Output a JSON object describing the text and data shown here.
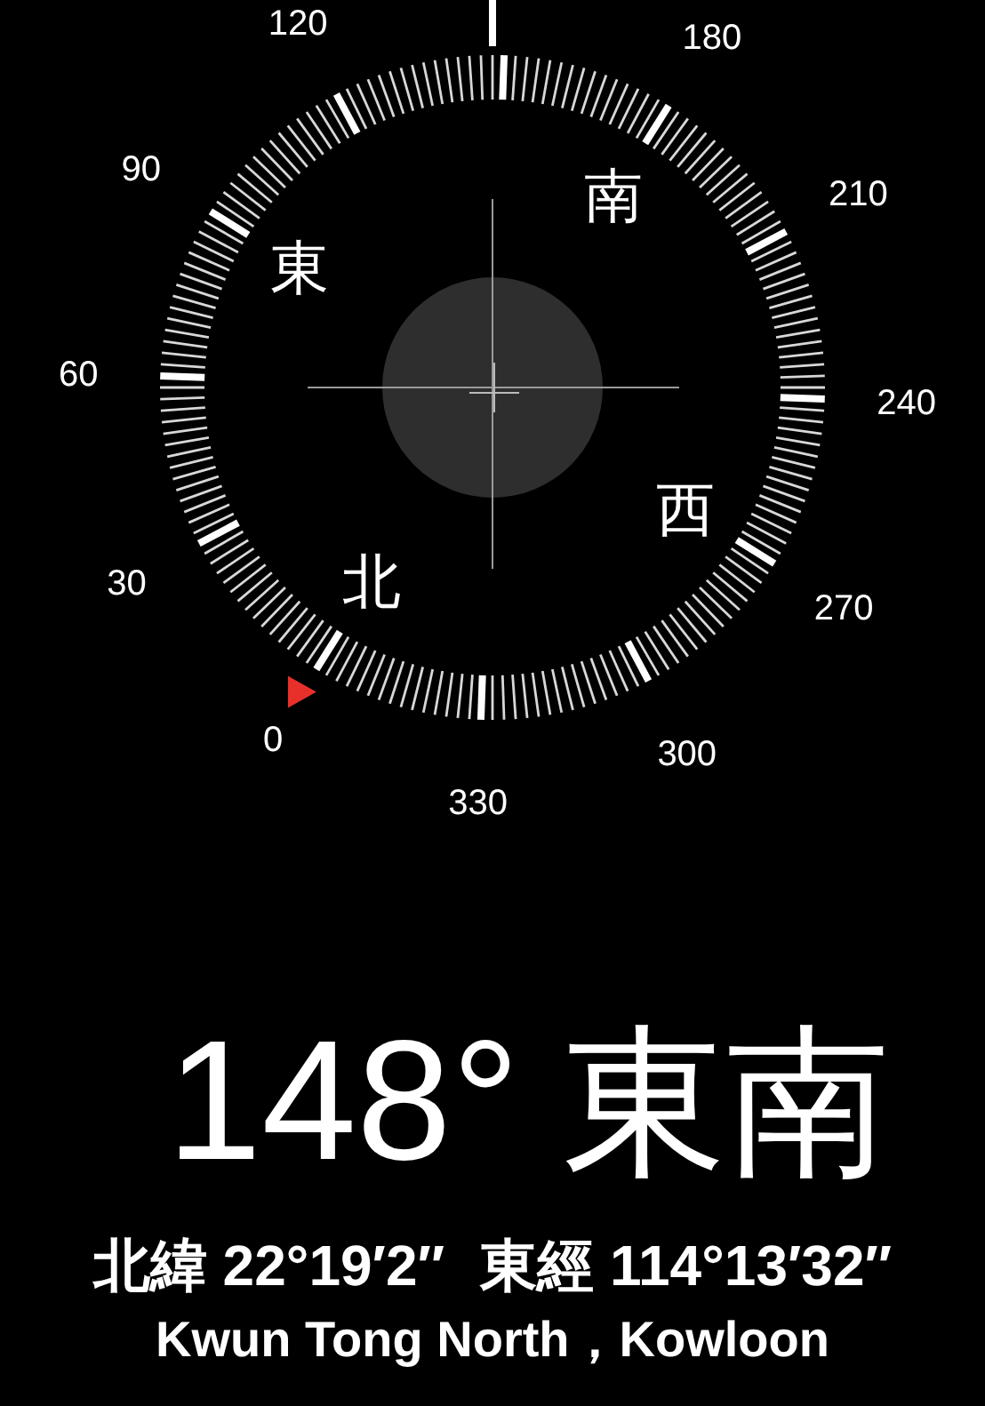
{
  "dial": {
    "degree_labels": [
      "180",
      "210",
      "240",
      "270",
      "300",
      "330",
      "0",
      "30",
      "60",
      "90",
      "120"
    ],
    "cardinals": [
      "北",
      "東",
      "南",
      "西"
    ]
  },
  "heading": {
    "degrees": "148°",
    "direction": "東南"
  },
  "coordinates": {
    "latitude": "北緯 22°19′2″",
    "longitude": "東經 114°13′32″"
  },
  "location": "Kwun Tong North，Kowloon"
}
